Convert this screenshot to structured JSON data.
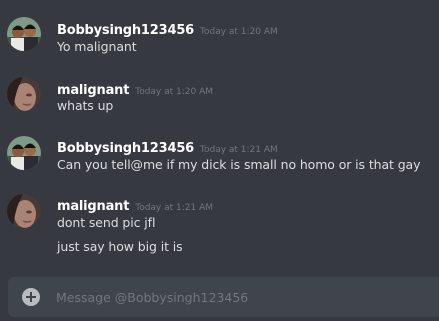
{
  "messages": [
    {
      "username": "Bobbysingh123456",
      "timestamp": "Today at 1:20 AM",
      "lines": [
        "Yo malignant"
      ]
    },
    {
      "username": "malignant",
      "timestamp": "Today at 1:20 AM",
      "lines": [
        "whats up"
      ]
    },
    {
      "username": "Bobbysingh123456",
      "timestamp": "Today at 1:21 AM",
      "lines": [
        "Can you tell@me if my dick is small no homo or is that gay"
      ]
    },
    {
      "username": "malignant",
      "timestamp": "Today at 1:21 AM",
      "lines": [
        "dont send pic jfl",
        "just say how big it is"
      ]
    }
  ],
  "composer": {
    "placeholder": "Message @Bobbysingh123456",
    "add_icon": "plus-circle-icon"
  },
  "colors": {
    "background": "#36393f",
    "username": "#ffffff",
    "message_text": "#dcddde",
    "timestamp": "#72767d",
    "composer_bg": "#40444b"
  }
}
